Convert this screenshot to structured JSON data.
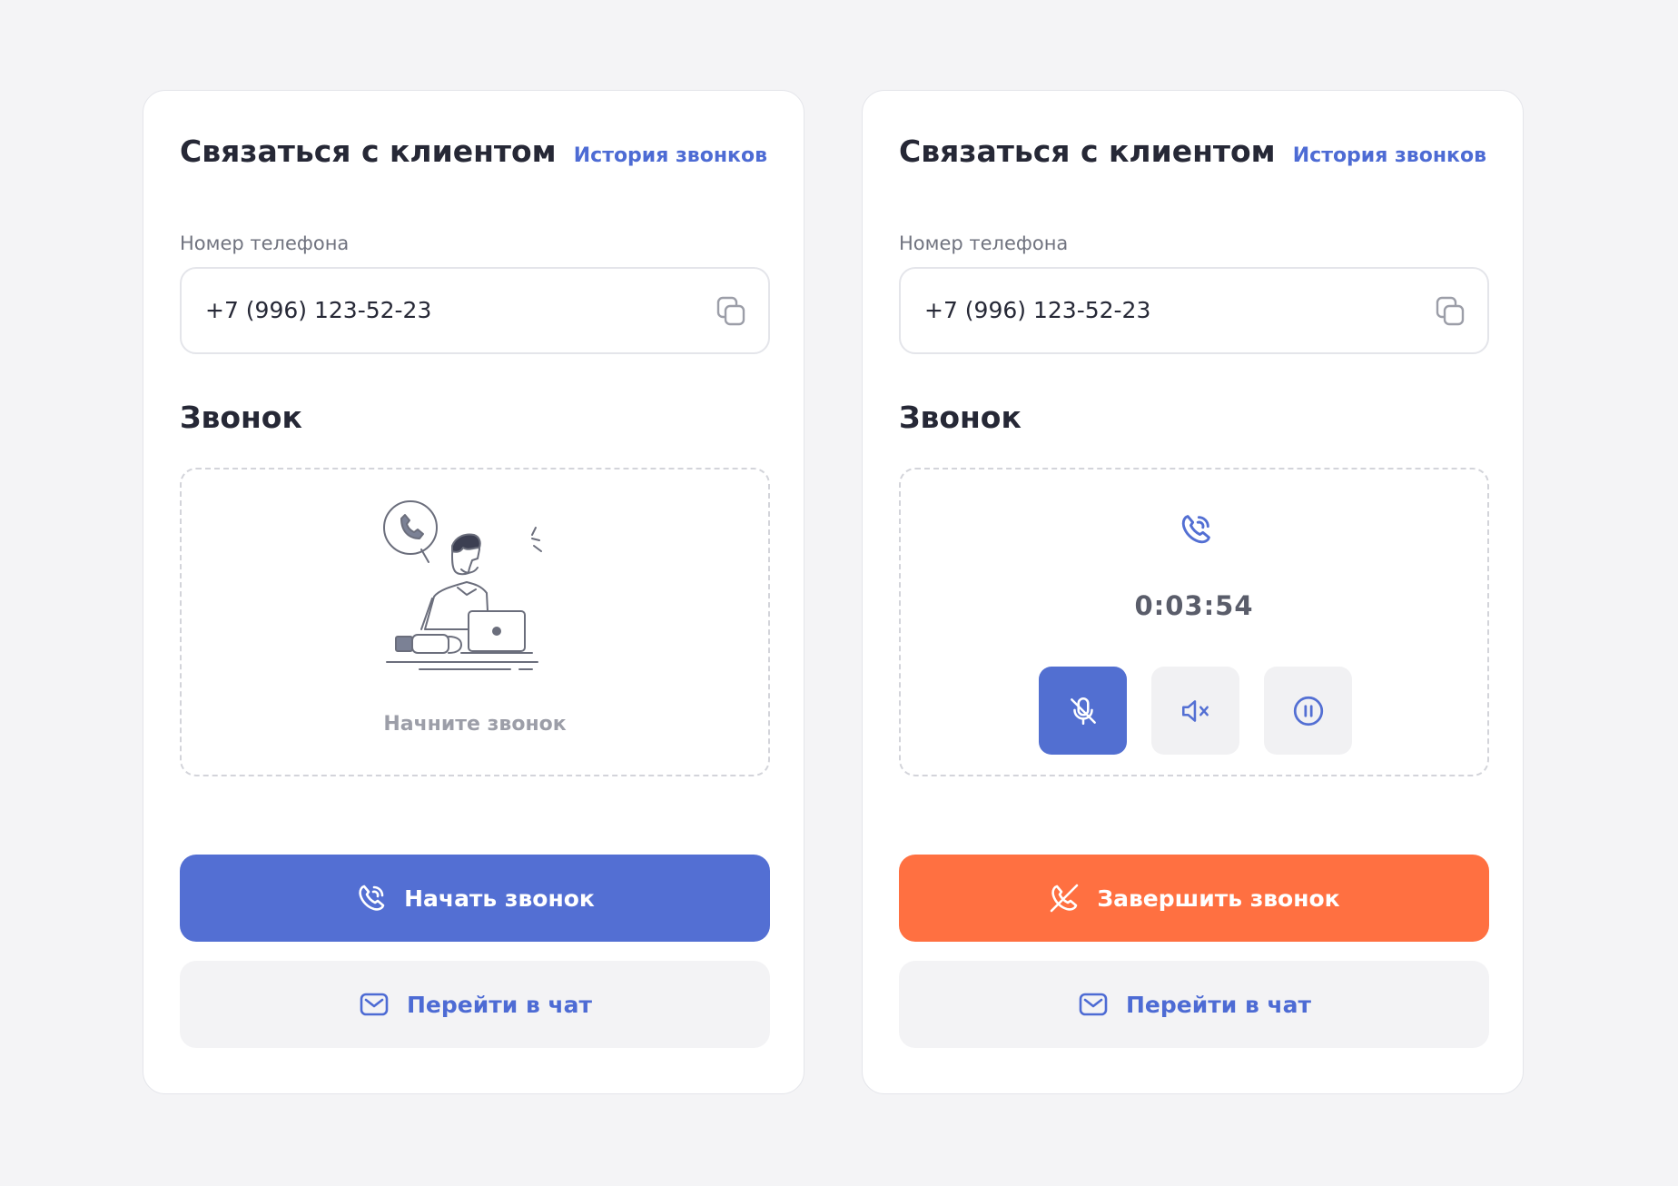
{
  "cards": [
    {
      "title": "Связаться с клиентом",
      "history_link": "История звонков",
      "phone_label": "Номер телефона",
      "phone_value": "+7 (996) 123-52-23",
      "section_title": "Звонок",
      "empty_caption": "Начните звонок",
      "primary_button": "Начать звонок",
      "secondary_button": "Перейти в чат"
    },
    {
      "title": "Связаться с клиентом",
      "history_link": "История звонков",
      "phone_label": "Номер телефона",
      "phone_value": "+7 (996) 123-52-23",
      "section_title": "Звонок",
      "timer": "0:03:54",
      "primary_button": "Завершить звонок",
      "secondary_button": "Перейти в чат"
    }
  ],
  "colors": {
    "accent": "#536fd3",
    "danger": "#ff7041",
    "background": "#f4f4f6"
  },
  "icons": [
    "copy-icon",
    "phone-call-icon",
    "mic-off-icon",
    "speaker-mute-icon",
    "pause-icon",
    "phone-off-icon",
    "mail-icon"
  ]
}
